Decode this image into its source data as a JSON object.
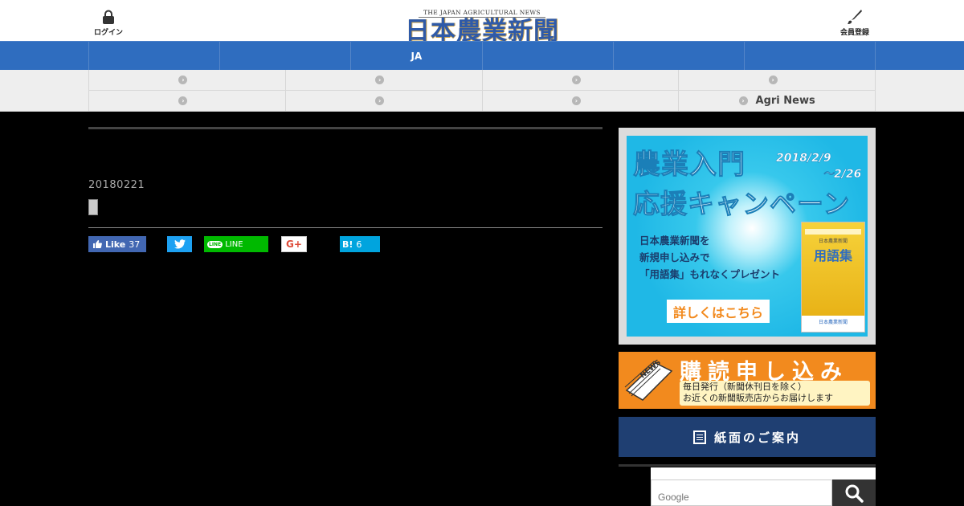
{
  "header": {
    "login_label": "ログイン",
    "register_label": "会員登録",
    "logo_en": "THE JAPAN AGRICULTURAL NEWS",
    "logo_jp": "日本農業新聞"
  },
  "nav_main": [
    "",
    "",
    "JA",
    "",
    "",
    ""
  ],
  "nav_sub_row1": [
    "",
    "",
    "",
    ""
  ],
  "nav_sub_row2": [
    "",
    "",
    "",
    "Agri News"
  ],
  "article": {
    "date": "20180221"
  },
  "share": {
    "facebook_label": "Like",
    "facebook_count": "37",
    "line_label": "LINE",
    "line_pill": "LINE",
    "google_label": "G+",
    "hatena_label": "B!",
    "hatena_count": "6"
  },
  "campaign": {
    "title_line1": "農業入門",
    "title_line2": "応援キャンペーン",
    "date_start": "2018/2/9",
    "date_end": "～2/26",
    "body_line1": "日本農業新聞を",
    "body_line2": "新規申し込みで",
    "body_line3": "「用語集」もれなくプレゼント",
    "cta": "詳しくはこちら",
    "book_header": "日本農業新聞",
    "book_title": "用語集",
    "book_footer": "日本農業新聞"
  },
  "subscribe": {
    "title": "購読申し込み",
    "note_line1": "毎日発行（新聞休刊日を除く）",
    "note_line2": "お近くの新聞販売店からお届けします",
    "paper_label": "NEWS"
  },
  "paper_guide": {
    "label": "紙面のご案内"
  },
  "search": {
    "placeholder": "Google"
  },
  "colors": {
    "nav_blue": "#2f6dbf",
    "subscribe_orange": "#f28a1e",
    "guide_navy": "#1f3f72",
    "facebook": "#4267b2",
    "twitter": "#1da1f2",
    "line": "#00b900",
    "hatena": "#00a4de"
  }
}
